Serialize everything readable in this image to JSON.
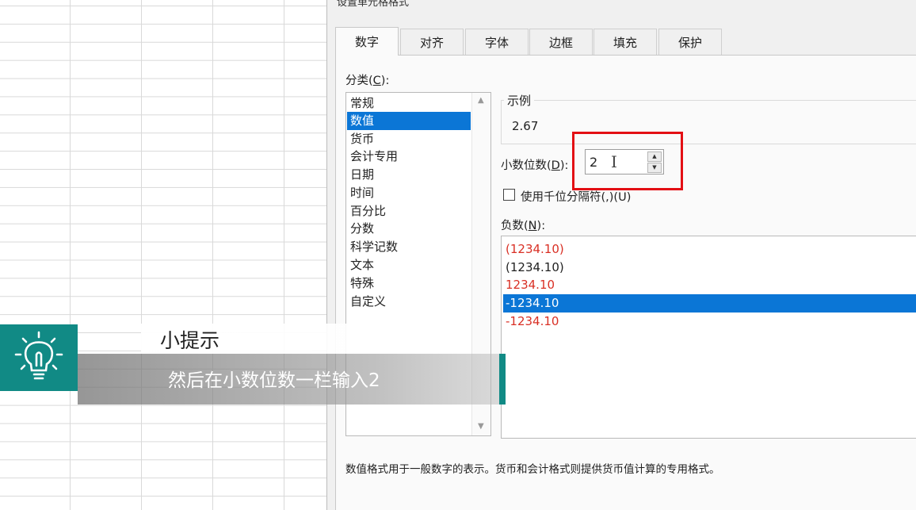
{
  "dialog": {
    "title": "设置单元格格式",
    "tabs": [
      "数字",
      "对齐",
      "字体",
      "边框",
      "填充",
      "保护"
    ],
    "active_tab": "数字"
  },
  "category": {
    "label_prefix": "分类(",
    "label_key": "C",
    "label_suffix": "):",
    "items": [
      "常规",
      "数值",
      "货币",
      "会计专用",
      "日期",
      "时间",
      "百分比",
      "分数",
      "科学记数",
      "文本",
      "特殊",
      "自定义"
    ],
    "selected": "数值"
  },
  "sample": {
    "legend": "示例",
    "value": "2.67"
  },
  "decimals": {
    "label_prefix": "小数位数(",
    "label_key": "D",
    "label_suffix": "):",
    "value": "2"
  },
  "thousands": {
    "label": "使用千位分隔符(,)(U)",
    "checked": false
  },
  "negative": {
    "label_prefix": "负数(",
    "label_key": "N",
    "label_suffix": "):",
    "items": [
      {
        "text": "(1234.10)",
        "color": "#d93025"
      },
      {
        "text": "(1234.10)",
        "color": "#222222"
      },
      {
        "text": "1234.10",
        "color": "#d93025"
      },
      {
        "text": "-1234.10",
        "color": "#222222"
      },
      {
        "text": "-1234.10",
        "color": "#d93025"
      }
    ],
    "selected_index": 3
  },
  "description": "数值格式用于一般数字的表示。货币和会计格式则提供货币值计算的专用格式。",
  "tip": {
    "title": "小提示",
    "text": "然后在小数位数一栏输入2",
    "icon": "lightbulb-icon",
    "accent_color": "#118a85"
  },
  "colors": {
    "selection": "#0b76d6",
    "highlight_box": "#e30f14"
  }
}
